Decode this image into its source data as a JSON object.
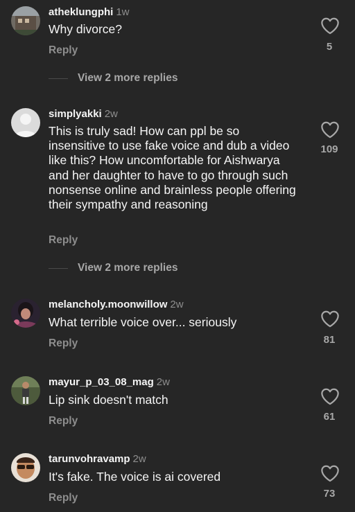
{
  "comments": [
    {
      "username": "atheklungphi",
      "time": "1w",
      "text": "Why divorce?",
      "reply_label": "Reply",
      "likes": "5",
      "view_more": "View 2 more replies"
    },
    {
      "username": "simplyakki",
      "time": "2w",
      "text": "This is truly sad! How can ppl be so insensitive to use fake voice and dub a video like this? How uncomfortable for Aishwarya and her daughter to have to go through such nonsense online and brainless people offering their sympathy and reasoning",
      "reply_label": "Reply",
      "likes": "109",
      "view_more": "View 2 more replies"
    },
    {
      "username": "melancholy.moonwillow",
      "time": "2w",
      "text": "What terrible voice over... seriously",
      "reply_label": "Reply",
      "likes": "81"
    },
    {
      "username": "mayur_p_03_08_mag",
      "time": "2w",
      "text": "Lip sink doesn't match",
      "reply_label": "Reply",
      "likes": "61"
    },
    {
      "username": "tarunvohravamp",
      "time": "2w",
      "text": "It's fake. The voice is ai covered",
      "reply_label": "Reply",
      "likes": "73"
    }
  ],
  "colors": {
    "background": "#262626",
    "primary_text": "#f5f5f5",
    "secondary_text": "#8e8e8e",
    "icon": "#a8a8a8"
  },
  "icons": {
    "like": "heart-outline-icon"
  }
}
